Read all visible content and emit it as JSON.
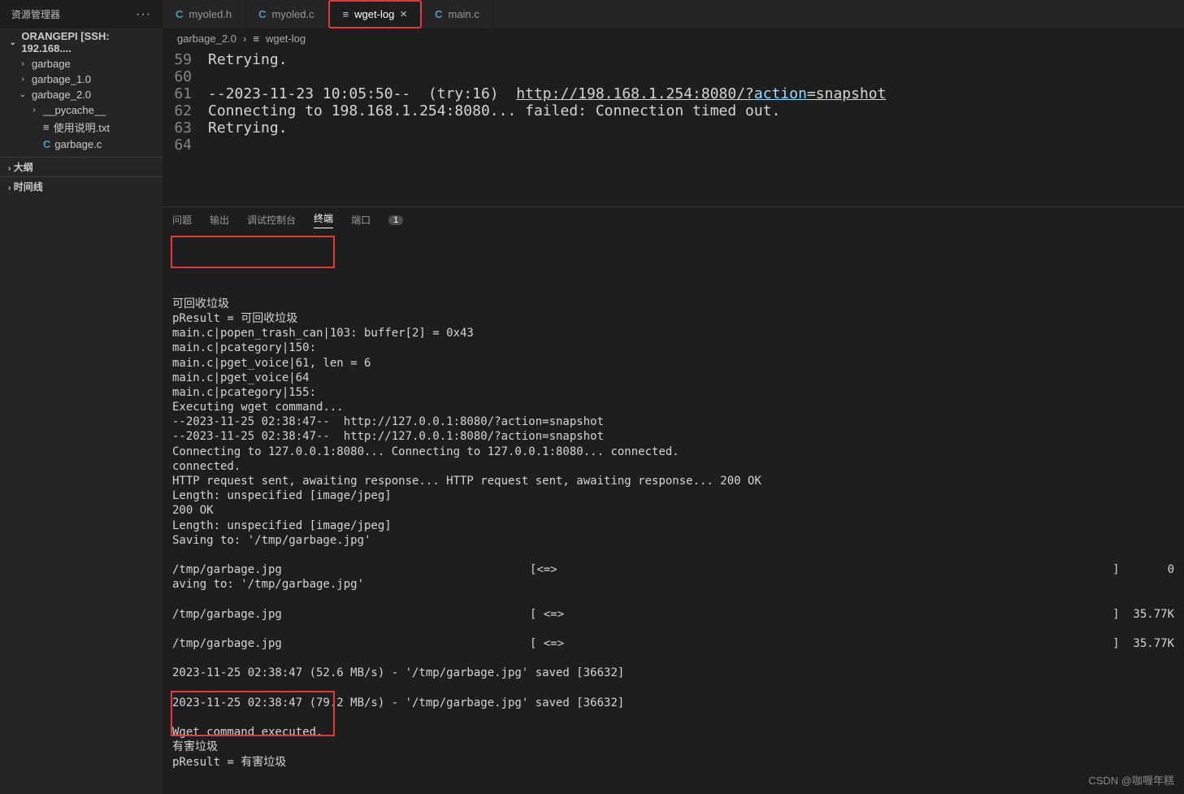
{
  "sidebar": {
    "title": "资源管理器",
    "remote": "ORANGEPI [SSH: 192.168....",
    "folders": [
      {
        "label": "garbage",
        "chev": "›",
        "indent": "indent1"
      },
      {
        "label": "garbage_1.0",
        "chev": "›",
        "indent": "indent1"
      },
      {
        "label": "garbage_2.0",
        "chev": "⌄",
        "indent": "indent1"
      },
      {
        "label": "__pycache__",
        "chev": "›",
        "indent": "indent2"
      },
      {
        "label": "使用说明.txt",
        "chev": "",
        "indent": "indent2",
        "icon": "≡"
      },
      {
        "label": "garbage.c",
        "chev": "",
        "indent": "indent2",
        "icon": "C"
      }
    ],
    "sections": [
      "大纲",
      "时间线"
    ]
  },
  "tabs": [
    {
      "label": "myoled.h",
      "icon": "C"
    },
    {
      "label": "myoled.c",
      "icon": "C"
    },
    {
      "label": "wget-log",
      "icon": "≡",
      "active": true,
      "hl": true,
      "close": true
    },
    {
      "label": "main.c",
      "icon": "C"
    }
  ],
  "breadcrumb": {
    "a": "garbage_2.0",
    "b": "wget-log",
    "icon": "≡"
  },
  "editor": [
    {
      "n": "59",
      "t": "Retrying."
    },
    {
      "n": "60",
      "t": ""
    },
    {
      "n": "61",
      "parts": [
        {
          "t": "--2023-11-23 10:05:50--  (try:16)  "
        },
        {
          "t": "http://198.168.1.254:8080/?",
          "cls": "url"
        },
        {
          "t": "action",
          "cls": "act url"
        },
        {
          "t": "=snapshot",
          "cls": "url"
        }
      ]
    },
    {
      "n": "62",
      "t": "Connecting to 198.168.1.254:8080... failed: Connection timed out."
    },
    {
      "n": "63",
      "t": "Retrying."
    },
    {
      "n": "64",
      "t": ""
    }
  ],
  "panel": {
    "items": [
      "问题",
      "输出",
      "调试控制台",
      "终端",
      "端口"
    ],
    "badge": "1"
  },
  "terminal": {
    "lines": [
      "可回收垃圾",
      "pResult = 可回收垃圾",
      "main.c|popen_trash_can|103: buffer[2] = 0x43",
      "main.c|pcategory|150:",
      "main.c|pget_voice|61, len = 6",
      "main.c|pget_voice|64",
      "main.c|pcategory|155:",
      "Executing wget command...",
      "--2023-11-25 02:38:47--  http://127.0.0.1:8080/?action=snapshot",
      "--2023-11-25 02:38:47--  http://127.0.0.1:8080/?action=snapshot",
      "Connecting to 127.0.0.1:8080... Connecting to 127.0.0.1:8080... connected.",
      "connected.",
      "HTTP request sent, awaiting response... HTTP request sent, awaiting response... 200 OK",
      "Length: unspecified [image/jpeg]",
      "200 OK",
      "Length: unspecified [image/jpeg]",
      "Saving to: '/tmp/garbage.jpg'",
      ""
    ],
    "progress": [
      {
        "l": "/tmp/garbage.jpg",
        "m": "[<=>",
        "r": "]       0",
        "tail": "aving to: '/tmp/garbage.jpg'"
      },
      {
        "l": "/tmp/garbage.jpg",
        "m": "[ <=>",
        "r": "]  35.77K"
      },
      {
        "l": "/tmp/garbage.jpg",
        "m": "[ <=>",
        "r": "]  35.77K"
      }
    ],
    "saved": [
      "2023-11-25 02:38:47 (52.6 MB/s) - '/tmp/garbage.jpg' saved [36632]",
      "",
      "2023-11-25 02:38:47 (79.2 MB/s) - '/tmp/garbage.jpg' saved [36632]",
      "",
      "Wget command executed.",
      "有害垃圾",
      "pResult = 有害垃圾"
    ]
  },
  "watermark": "CSDN @咖喱年糕"
}
